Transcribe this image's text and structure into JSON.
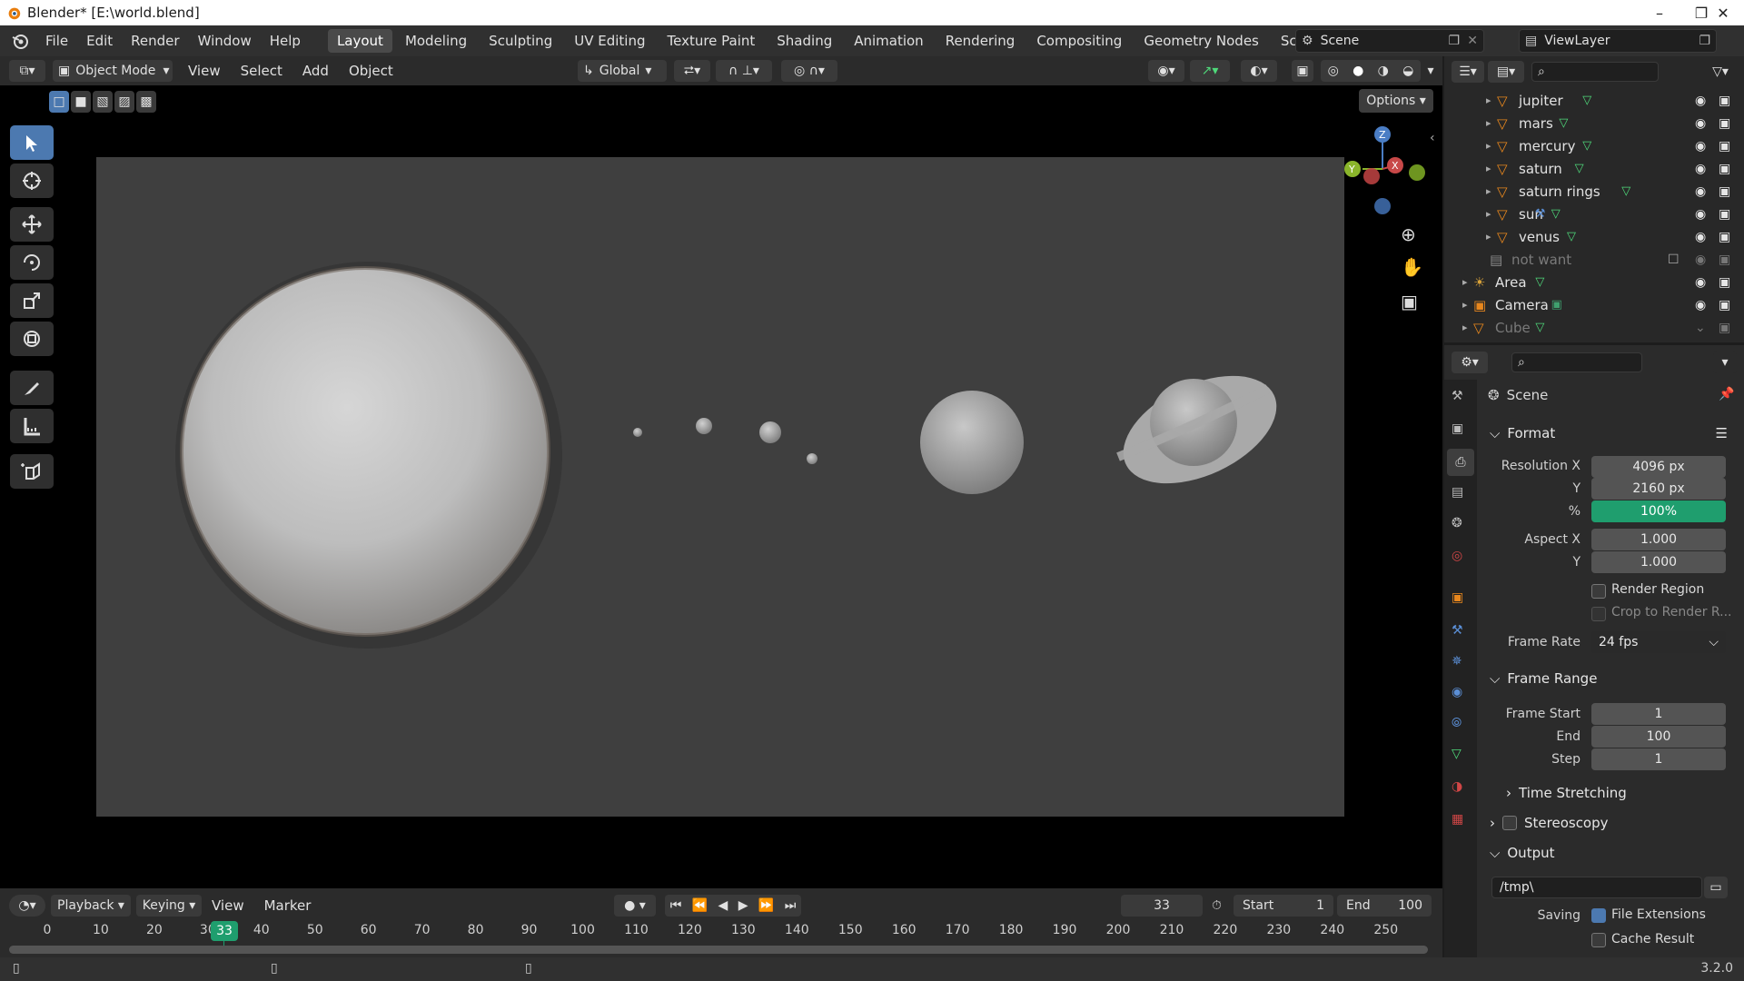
{
  "window": {
    "title": "Blender* [E:\\world.blend]"
  },
  "topbar": {
    "menus": [
      "File",
      "Edit",
      "Render",
      "Window",
      "Help"
    ],
    "workspaces": [
      "Layout",
      "Modeling",
      "Sculpting",
      "UV Editing",
      "Texture Paint",
      "Shading",
      "Animation",
      "Rendering",
      "Compositing",
      "Geometry Nodes",
      "Scripting"
    ],
    "add_tab": "+",
    "scene": "Scene",
    "view_layer": "ViewLayer"
  },
  "viewport_header": {
    "mode": "Object Mode",
    "menus": [
      "View",
      "Select",
      "Add",
      "Object"
    ],
    "orientation": "Global",
    "options": "Options"
  },
  "outliner": {
    "rows": [
      {
        "name": "jupiter",
        "dim": false
      },
      {
        "name": "mars",
        "dim": false
      },
      {
        "name": "mercury",
        "dim": false
      },
      {
        "name": "saturn",
        "dim": false
      },
      {
        "name": "saturn rings",
        "dim": false
      },
      {
        "name": "sun",
        "dim": false
      },
      {
        "name": "venus",
        "dim": false
      },
      {
        "name": "not want",
        "dim": true
      },
      {
        "name": "Area",
        "dim": false
      },
      {
        "name": "Camera",
        "dim": false
      },
      {
        "name": "Cube",
        "dim": true
      }
    ]
  },
  "properties": {
    "context": "Scene",
    "format": {
      "title": "Format",
      "res_x_label": "Resolution X",
      "res_x": "4096 px",
      "res_y_label": "Y",
      "res_y": "2160 px",
      "pct_label": "%",
      "pct": "100%",
      "aspect_x_label": "Aspect X",
      "aspect_x": "1.000",
      "aspect_y_label": "Y",
      "aspect_y": "1.000",
      "render_region": "Render Region",
      "crop": "Crop to Render R...",
      "frame_rate_label": "Frame Rate",
      "frame_rate": "24 fps"
    },
    "frame_range": {
      "title": "Frame Range",
      "start_label": "Frame Start",
      "start": "1",
      "end_label": "End",
      "end": "100",
      "step_label": "Step",
      "step": "1"
    },
    "time_stretching": "Time Stretching",
    "stereoscopy": "Stereoscopy",
    "output": {
      "title": "Output",
      "path": "/tmp\\",
      "saving_label": "Saving",
      "file_extensions": "File Extensions",
      "cache_result": "Cache Result"
    }
  },
  "timeline": {
    "menus": [
      "Playback",
      "Keying",
      "View",
      "Marker"
    ],
    "current_frame": "33",
    "start_label": "Start",
    "start": "1",
    "end_label": "End",
    "end": "100",
    "ticks": [
      "0",
      "10",
      "20",
      "30",
      "40",
      "50",
      "60",
      "70",
      "80",
      "90",
      "100",
      "110",
      "120",
      "130",
      "140",
      "150",
      "160",
      "170",
      "180",
      "190",
      "200",
      "210",
      "220",
      "230",
      "240",
      "250"
    ]
  },
  "statusbar": {
    "version": "3.2.0"
  },
  "colors": {
    "accent": "#4c79b0",
    "green": "#1f9e6e",
    "frame_bg": "#3f3f3f"
  }
}
